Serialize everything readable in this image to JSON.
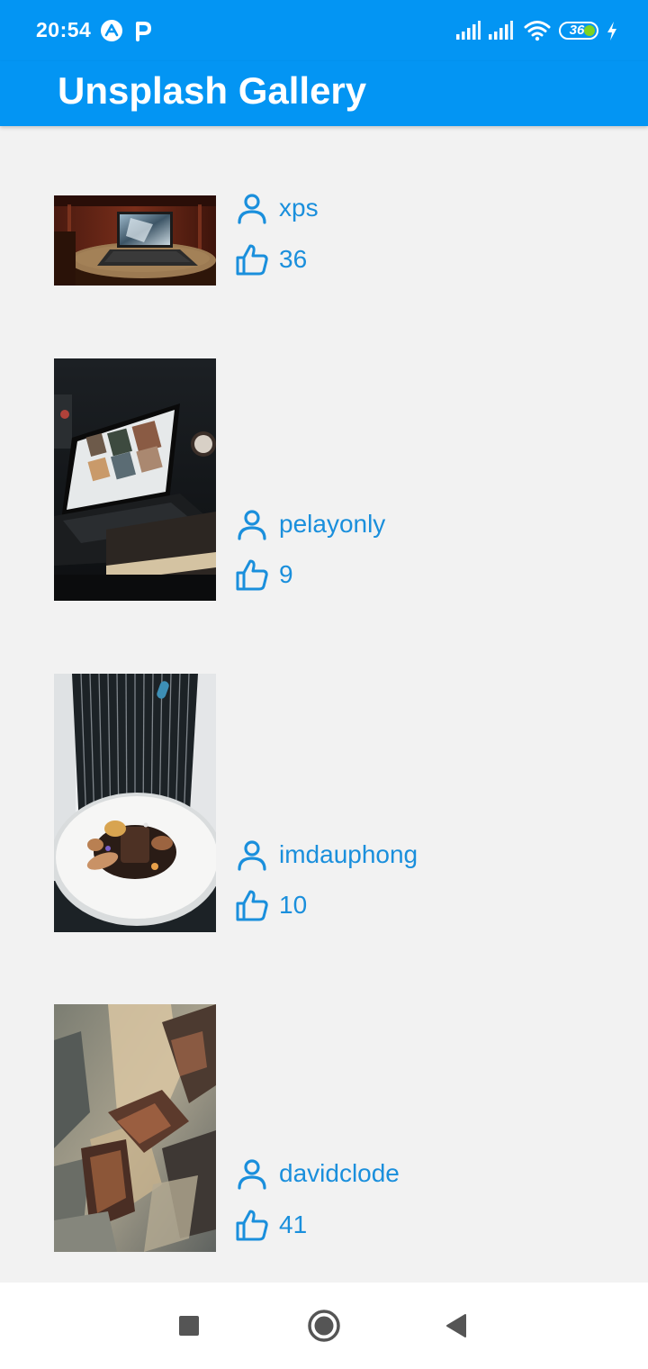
{
  "status_bar": {
    "time": "20:54",
    "battery": "36",
    "icons": [
      "app-a-icon",
      "app-p-icon",
      "signal-icon",
      "signal-icon",
      "wifi-icon",
      "battery-icon",
      "charging-icon"
    ]
  },
  "app_bar": {
    "title": "Unsplash Gallery",
    "color": "#0395f3"
  },
  "photos": [
    {
      "user": "xps",
      "likes": "36",
      "subject": "laptop-on-round-table"
    },
    {
      "user": "pelayonly",
      "likes": "9",
      "subject": "laptop-screen-dark"
    },
    {
      "user": "imdauphong",
      "likes": "10",
      "subject": "plated-dish-chef"
    },
    {
      "user": "davidclode",
      "likes": "41",
      "subject": "tree-bark-texture"
    }
  ],
  "nav_bar": {
    "icons": [
      "recent-apps-icon",
      "home-icon",
      "back-icon"
    ]
  },
  "colors": {
    "accent": "#0395f3",
    "text_accent": "#1a8fdc",
    "background": "#f2f2f2"
  }
}
